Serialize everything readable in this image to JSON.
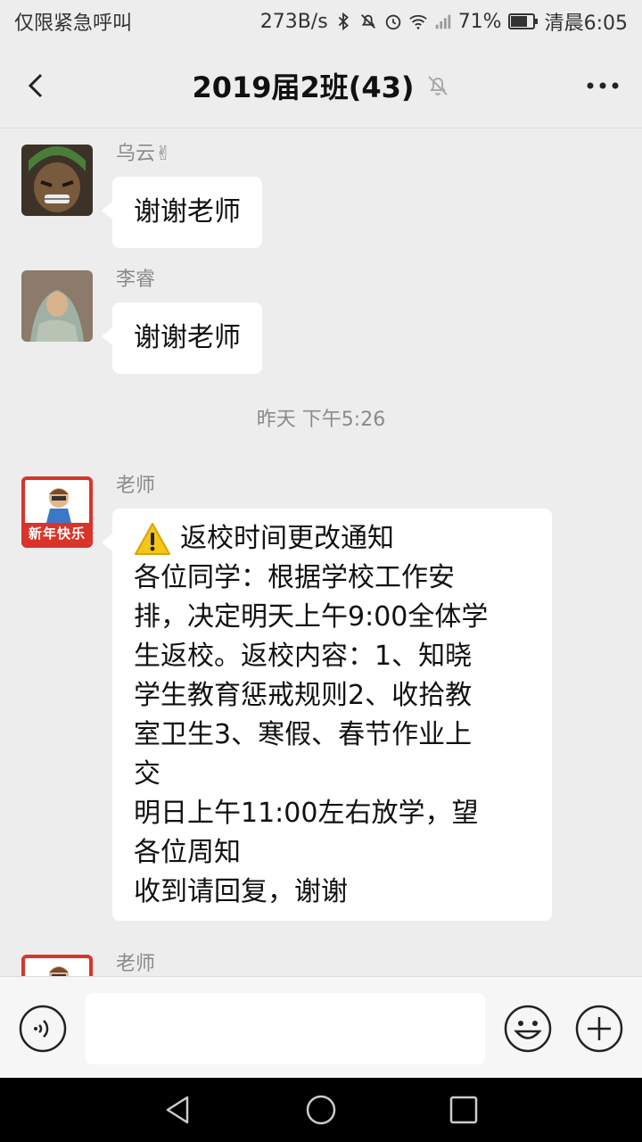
{
  "status": {
    "carrier": "仅限紧急呼叫",
    "speed": "273B/s",
    "battery": "71%",
    "time": "清晨6:05"
  },
  "header": {
    "title": "2019届2班(43)"
  },
  "messages": [
    {
      "sender": "乌云✌",
      "text": "谢谢老师"
    },
    {
      "sender": "李睿",
      "text": "谢谢老师"
    }
  ],
  "timestamp": "昨天 下午5:26",
  "teacher": {
    "sender": "老师",
    "avatar_label": "新年快乐",
    "title": "返校时间更改通知",
    "lines": [
      "各位同学：根据学校工作安",
      "排，决定明天上午9:00全体学",
      "生返校。返校内容：1、知晓",
      "学生教育惩戒规则2、收拾教",
      "室卫生3、寒假、春节作业上",
      "交",
      "明日上午11:00左右放学，望",
      "各位周知",
      "收到请回复，谢谢"
    ]
  },
  "teacher_next": {
    "sender": "老师"
  },
  "input": {
    "value": ""
  },
  "colors": {
    "accent": "#d9342b",
    "background": "#ededed",
    "bubble": "#ffffff"
  },
  "icons": [
    "back-arrow-icon",
    "mute-bell-icon",
    "more-icon",
    "voice-icon",
    "emoji-icon",
    "plus-icon",
    "bluetooth-icon",
    "silent-icon",
    "alarm-icon",
    "wifi-icon",
    "signal-icon",
    "battery-icon"
  ]
}
